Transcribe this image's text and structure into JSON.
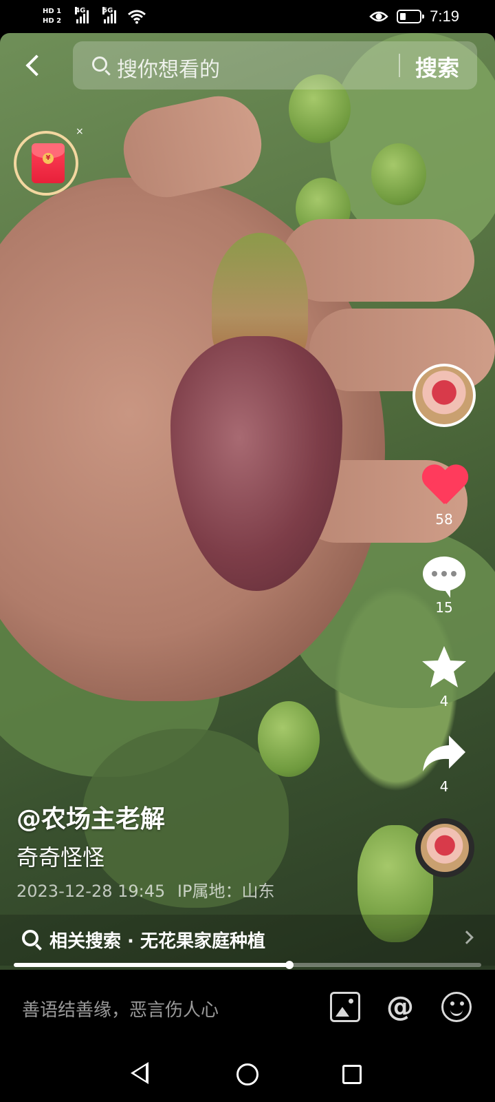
{
  "status_bar": {
    "sim1_label": "HD 1",
    "sim2_label": "HD 2",
    "network1": "4G",
    "network2": "5G",
    "time": "7:19"
  },
  "search": {
    "placeholder": "搜你想看的",
    "button_label": "搜索"
  },
  "actions": {
    "likes": "58",
    "comments": "15",
    "favorites": "4",
    "shares": "4"
  },
  "post": {
    "author": "@农场主老解",
    "description": "奇奇怪怪",
    "date": "2023-12-28 19:45",
    "ip_location": "IP属地：山东"
  },
  "related_search": {
    "label": "相关搜索 · 无花果家庭种植"
  },
  "playback": {
    "progress": 0.59
  },
  "comment_bar": {
    "placeholder": "善语结善缘，恶言伤人心"
  },
  "icons": {
    "back": "chevron-left",
    "search": "magnifier",
    "red_packet": "red-envelope",
    "like": "heart",
    "comment": "speech-bubble",
    "favorite": "star",
    "share": "share-arrow",
    "image": "image",
    "mention": "at-sign",
    "emoji": "smiley"
  },
  "colors": {
    "like": "#ff3b5c",
    "red_packet": "#e8203a",
    "ring": "#f3d7a0"
  }
}
